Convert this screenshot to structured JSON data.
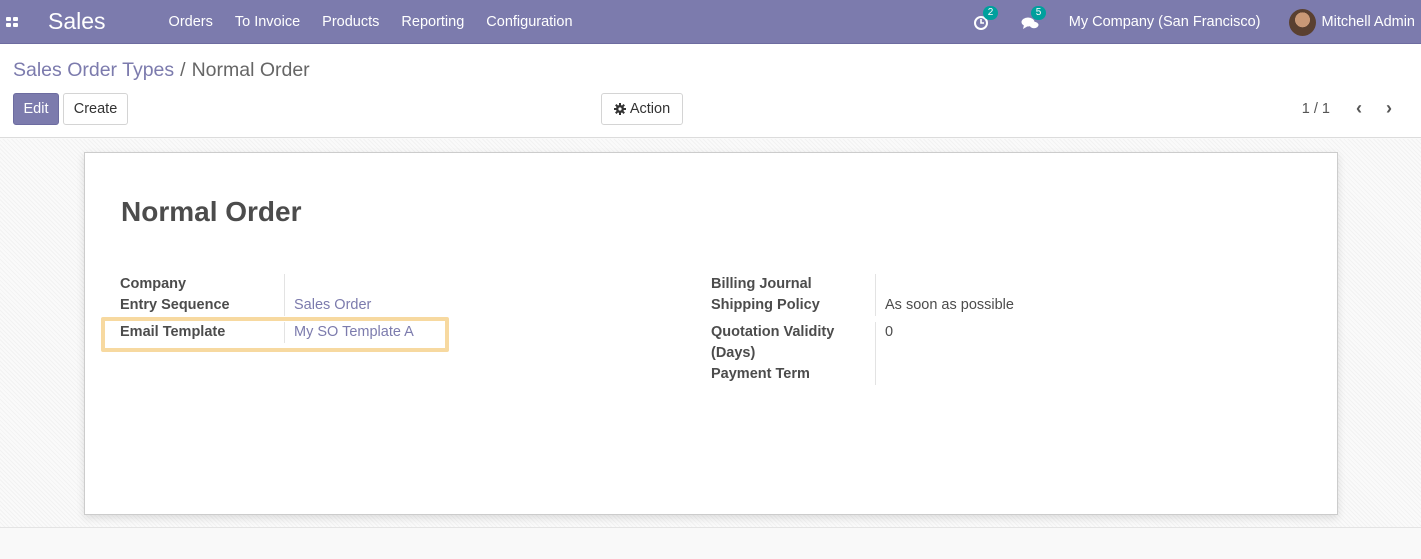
{
  "navbar": {
    "app_name": "Sales",
    "menu": [
      "Orders",
      "To Invoice",
      "Products",
      "Reporting",
      "Configuration"
    ],
    "activity_count": "2",
    "message_count": "5",
    "company": "My Company (San Francisco)",
    "user": "Mitchell Admin",
    "bg_color": "#7c7bad"
  },
  "breadcrumb": {
    "parent": "Sales Order Types",
    "separator": "/",
    "current": "Normal Order"
  },
  "buttons": {
    "edit": "Edit",
    "create": "Create",
    "action": "Action"
  },
  "pager": {
    "value": "1 / 1"
  },
  "record": {
    "name": "Normal Order",
    "left_fields": [
      {
        "label": "Company",
        "value": ""
      },
      {
        "label": "Entry Sequence",
        "value": "Sales Order"
      },
      {
        "label": "Email Template",
        "value": "My SO Template A"
      }
    ],
    "right_fields": [
      {
        "label": "Billing Journal",
        "value": ""
      },
      {
        "label": "Shipping Policy",
        "value": "As soon as possible"
      },
      {
        "label": "Quotation Validity (Days)",
        "value": "0"
      },
      {
        "label": "Payment Term",
        "value": ""
      }
    ]
  },
  "icons": {
    "apps": "apps-grid-icon",
    "activity": "clock-icon",
    "messages": "chat-bubbles-icon",
    "action": "gear-icon",
    "prev": "chevron-left-icon",
    "next": "chevron-right-icon"
  }
}
